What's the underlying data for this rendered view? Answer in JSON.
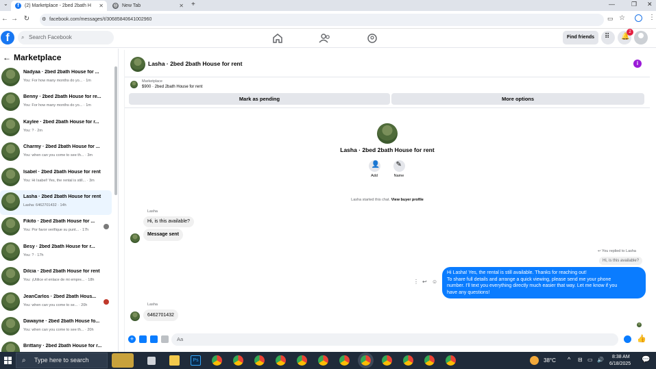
{
  "browser": {
    "tabs": [
      {
        "title": "(2) Marketplace - 2bed 2bath H",
        "active": true
      },
      {
        "title": "New Tab",
        "active": false
      }
    ],
    "url": "facebook.com/messages/t/306858406410029​60"
  },
  "fb": {
    "search_placeholder": "Search Facebook",
    "find_friends": "Find friends",
    "notif_count": "2"
  },
  "sidebar": {
    "title": "Marketplace",
    "conversations": [
      {
        "name": "Nadyaa · 2bed 2bath House for ...",
        "preview": "You: For how many months do yo... · 1m",
        "active": false
      },
      {
        "name": "Benny · 2bed 2bath House for re...",
        "preview": "You: For how many months do yo... · 1m",
        "active": false
      },
      {
        "name": "Kaylee · 2bed 2bath House for r...",
        "preview": "You: ? · 2m",
        "active": false
      },
      {
        "name": "Charmy · 2bed 2bath House for ...",
        "preview": "You: when can you come to see th... · 3m",
        "active": false
      },
      {
        "name": "Isabel · 2bed 2bath House for rent",
        "preview": "You: Hi Isabel! Yes, the rental is still... · 3m",
        "active": false
      },
      {
        "name": "Lasha · 2bed 2bath House for rent",
        "preview": "Lasha: 6462701432 · 14h",
        "active": true
      },
      {
        "name": "Fikito · 2bed 2bath House for ...",
        "preview": "You: Por favor verifique su punt... · 17h",
        "active": false
      },
      {
        "name": "Besy · 2bed 2bath House for r...",
        "preview": "You: ? · 17h",
        "active": false
      },
      {
        "name": "Dilcia · 2bed 2bath House for rent",
        "preview": "You: ¡Utilice el enlace de mi empre... · 18h",
        "active": false
      },
      {
        "name": "JeanCarlos · 2bed 2bath Hous...",
        "preview": "You: when can you come to se... · 20h",
        "active": false
      },
      {
        "name": "Dawayne · 2bed 2bath House fo...",
        "preview": "You: when can you come to see th... · 20h",
        "active": false
      },
      {
        "name": "Brittany · 2bed 2bath House for r...",
        "preview": "",
        "active": false
      }
    ]
  },
  "chat": {
    "title": "Lasha · 2bed 2bath House for rent",
    "listing_source": "Marketplace",
    "listing_price": "$900 · 2bed 2bath House for rent",
    "mark_pending": "Mark as pending",
    "more_options": "More options",
    "profile_name": "Lasha · 2bed 2bath House for rent",
    "add_label": "Add",
    "name_label": "Name",
    "started_text": "Lasha started this chat.",
    "view_buyer": "View buyer profile",
    "sender1": "Lasha",
    "msg1": "Hi, is this available?",
    "msg2": "Message sent",
    "reply_label": "You replied to Lasha",
    "quoted": "Hi, is this available?",
    "out_line1": "Hi Lasha! Yes, the rental is still available. Thanks for reaching out!",
    "out_line2": "To share full details and arrange a quick viewing, please send me your phone",
    "out_line3": "number. I'll text you everything directly much easier that way. Let me know if you",
    "out_line4": "have any questions!",
    "sender2": "Lasha",
    "msg3": "6462701432",
    "composer_placeholder": "Aa"
  },
  "taskbar": {
    "search_placeholder": "Type here to search",
    "weather": "38°C",
    "time": "8:38 AM",
    "date": "6/18/2025"
  },
  "colors": {
    "fb_blue": "#1877f2",
    "messenger_blue": "#0a7cff",
    "active_conv": "#ebf5ff"
  }
}
